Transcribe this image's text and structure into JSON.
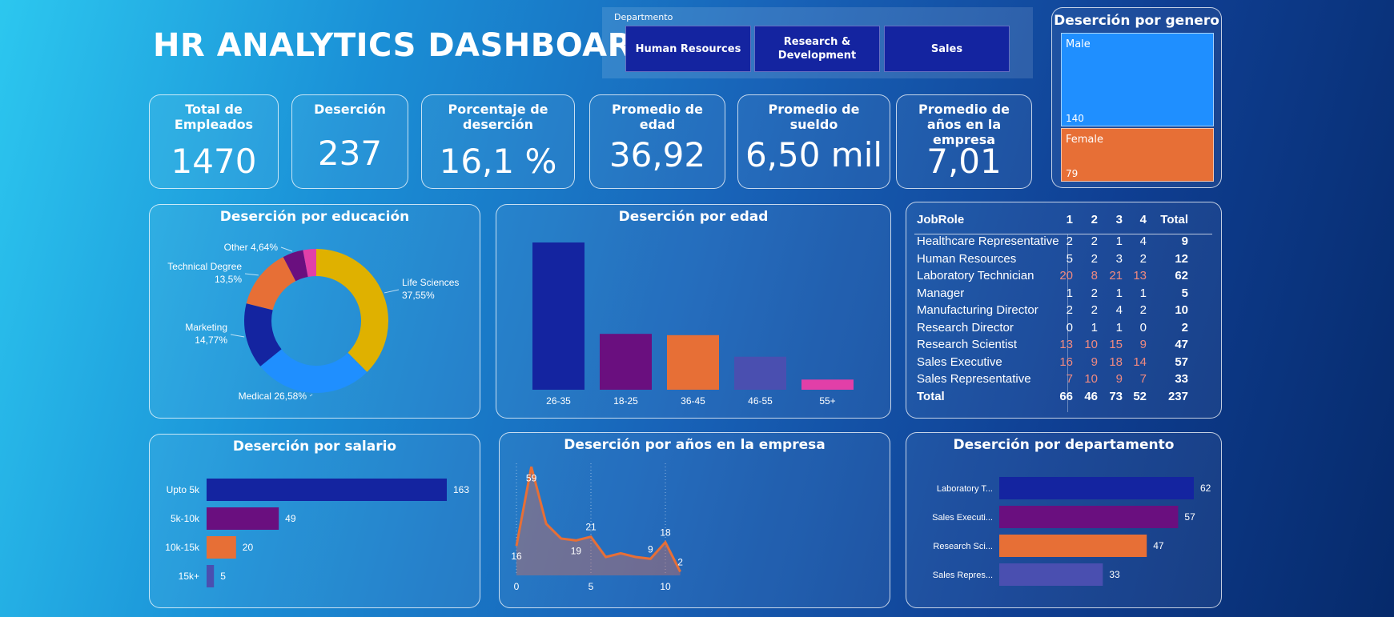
{
  "header": {
    "title": "HR ANALYTICS DASHBOARD"
  },
  "slicer": {
    "label": "Departmento",
    "options": [
      "Human Resources",
      "Research & Development",
      "Sales"
    ]
  },
  "kpis": [
    {
      "label": "Total de Empleados",
      "value": "1470"
    },
    {
      "label": "Deserción",
      "value": "237"
    },
    {
      "label": "Porcentaje de deserción",
      "value": "16,1 %"
    },
    {
      "label": "Promedio de edad",
      "value": "36,92"
    },
    {
      "label": "Promedio de sueldo",
      "value": "6,50 mil"
    },
    {
      "label": "Promedio de años en la empresa",
      "value": "7,01"
    }
  ],
  "colors": {
    "navy": "#1424a0",
    "purple": "#6a0f7f",
    "orange": "#e76f36",
    "indigo": "#4a4fb0",
    "pink": "#e23fa8",
    "gold": "#dfb100",
    "blue": "#1f8fff",
    "male": "#1f8fff",
    "female": "#e76f36",
    "highlight": "#f08a80"
  },
  "charts": {
    "gender": {
      "title": "Deserción por genero",
      "chart_data": {
        "type": "treemap",
        "items": [
          {
            "label": "Male",
            "value": 140
          },
          {
            "label": "Female",
            "value": 79
          }
        ]
      }
    },
    "education": {
      "title": "Deserción por educación",
      "chart_data": {
        "type": "pie",
        "slices": [
          {
            "label": "Life Sciences",
            "pct_label": "37,55%",
            "value": 37.55,
            "color": "#dfb100"
          },
          {
            "label": "Medical",
            "pct_label": "26,58%",
            "value": 26.58,
            "color": "#1f8fff"
          },
          {
            "label": "Marketing",
            "pct_label": "14,77%",
            "value": 14.77,
            "color": "#1424a0"
          },
          {
            "label": "Technical Degree",
            "pct_label": "13,5%",
            "value": 13.5,
            "color": "#e76f36"
          },
          {
            "label": "Other",
            "pct_label": "4,64%",
            "value": 4.64,
            "color": "#6a0f7f"
          },
          {
            "label": "",
            "pct_label": "",
            "value": 2.96,
            "color": "#e23fa8"
          }
        ]
      }
    },
    "age": {
      "title": "Deserción por edad",
      "chart_data": {
        "type": "bar",
        "categories": [
          "26-35",
          "18-25",
          "36-45",
          "46-55",
          "55+"
        ],
        "values": [
          116,
          44,
          43,
          26,
          8
        ],
        "colors": [
          "#1424a0",
          "#6a0f7f",
          "#e76f36",
          "#4a4fb0",
          "#e23fa8"
        ],
        "ylim": [
          0,
          116
        ]
      }
    },
    "jobrole": {
      "chart_data": {
        "type": "table",
        "columns": [
          "JobRole",
          "1",
          "2",
          "3",
          "4",
          "Total"
        ],
        "rows": [
          {
            "role": "Healthcare Representative",
            "v": [
              2,
              2,
              1,
              4
            ],
            "total": 9
          },
          {
            "role": "Human Resources",
            "v": [
              5,
              2,
              3,
              2
            ],
            "total": 12
          },
          {
            "role": "Laboratory Technician",
            "v": [
              20,
              8,
              21,
              13
            ],
            "total": 62,
            "highlight": true
          },
          {
            "role": "Manager",
            "v": [
              1,
              2,
              1,
              1
            ],
            "total": 5
          },
          {
            "role": "Manufacturing Director",
            "v": [
              2,
              2,
              4,
              2
            ],
            "total": 10
          },
          {
            "role": "Research Director",
            "v": [
              0,
              1,
              1,
              0
            ],
            "total": 2
          },
          {
            "role": "Research Scientist",
            "v": [
              13,
              10,
              15,
              9
            ],
            "total": 47,
            "highlight": true
          },
          {
            "role": "Sales Executive",
            "v": [
              16,
              9,
              18,
              14
            ],
            "total": 57,
            "highlight": true
          },
          {
            "role": "Sales Representative",
            "v": [
              7,
              10,
              9,
              7
            ],
            "total": 33,
            "highlight": true
          }
        ],
        "total_row": {
          "label": "Total",
          "v": [
            66,
            46,
            73,
            52
          ],
          "total": 237
        }
      }
    },
    "salary": {
      "title": "Deserción por salario",
      "chart_data": {
        "type": "bar",
        "orientation": "horizontal",
        "categories": [
          "Upto 5k",
          "5k-10k",
          "10k-15k",
          "15k+"
        ],
        "values": [
          163,
          49,
          20,
          5
        ],
        "colors": [
          "#1424a0",
          "#6a0f7f",
          "#e76f36",
          "#4a4fb0"
        ],
        "xlim": [
          0,
          163
        ]
      }
    },
    "years": {
      "title": "Deserción por años en la empresa",
      "chart_data": {
        "type": "area",
        "x": [
          0,
          1,
          2,
          3,
          4,
          5,
          6,
          7,
          8,
          9,
          10,
          11
        ],
        "y": [
          16,
          59,
          28,
          20,
          19,
          21,
          10,
          12,
          10,
          9,
          18,
          2
        ],
        "labeled_points": [
          0,
          1,
          4,
          5,
          9,
          10,
          11
        ],
        "x_ticks": [
          0,
          5,
          10
        ],
        "ylim": [
          0,
          60
        ],
        "color": "#e76f36"
      }
    },
    "department": {
      "title": "Deserción por departamento",
      "chart_data": {
        "type": "bar",
        "orientation": "horizontal",
        "categories": [
          "Laboratory T...",
          "Sales Executi...",
          "Research Sci...",
          "Sales Repres..."
        ],
        "values": [
          62,
          57,
          47,
          33
        ],
        "colors": [
          "#1424a0",
          "#6a0f7f",
          "#e76f36",
          "#4a4fb0"
        ],
        "xlim": [
          0,
          62
        ]
      }
    }
  }
}
